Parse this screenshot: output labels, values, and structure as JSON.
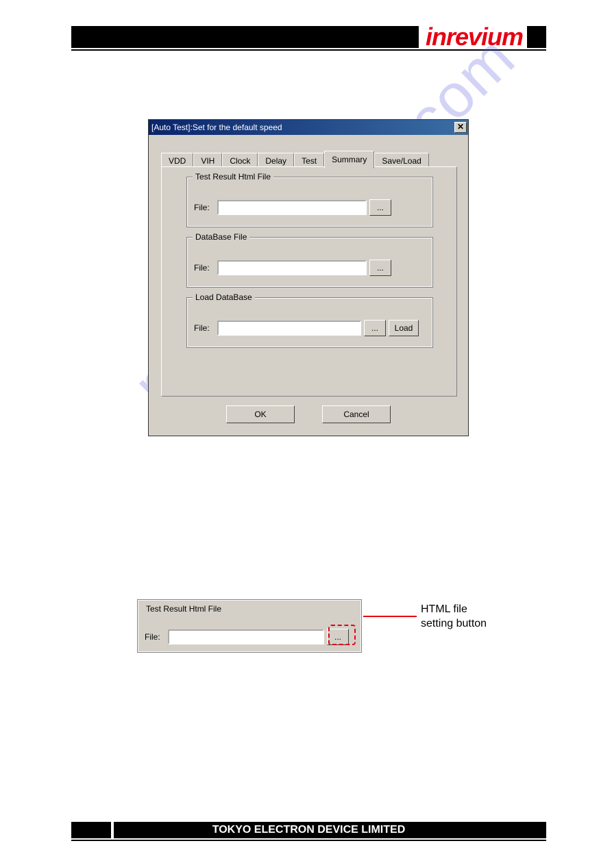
{
  "header": {
    "logo_text": "inrevium"
  },
  "dialog": {
    "title": "[Auto Test]:Set for the default speed",
    "close_glyph": "✕",
    "tabs": [
      "VDD",
      "VIH",
      "Clock",
      "Delay",
      "Test",
      "Summary",
      "Save/Load"
    ],
    "active_tab_index": 5,
    "groups": {
      "html": {
        "legend": "Test Result Html File",
        "file_label": "File:",
        "file_value": "",
        "browse_label": "..."
      },
      "db": {
        "legend": "DataBase File",
        "file_label": "File:",
        "file_value": "",
        "browse_label": "..."
      },
      "load": {
        "legend": "Load DataBase",
        "file_label": "File:",
        "file_value": "",
        "browse_label": "...",
        "load_label": "Load"
      }
    },
    "buttons": {
      "ok": "OK",
      "cancel": "Cancel"
    }
  },
  "callout": {
    "legend": "Test Result Html File",
    "file_label": "File:",
    "file_value": "",
    "browse_label": "...",
    "annotation": "HTML file\nsetting button"
  },
  "watermark": "manualshive.com",
  "footer": {
    "company": "TOKYO ELECTRON DEVICE LIMITED"
  }
}
